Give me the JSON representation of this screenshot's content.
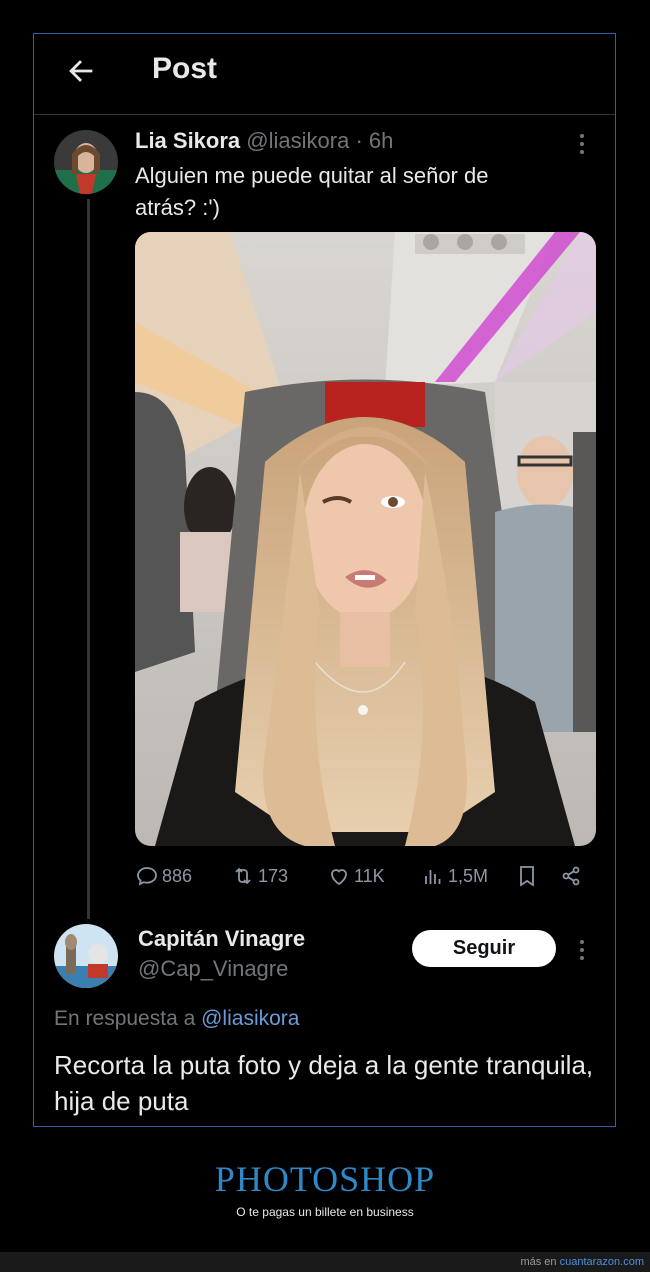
{
  "header": {
    "title": "Post"
  },
  "tweet": {
    "author_name": "Lia Sikora",
    "handle": "@liasikora",
    "separator": "·",
    "time": "6h",
    "text": "Alguien me puede quitar al señor de atrás? :')",
    "actions": {
      "replies": "886",
      "retweets": "173",
      "likes": "11K",
      "views": "1,5M"
    }
  },
  "reply": {
    "author_name": "Capitán Vinagre",
    "handle": "@Cap_Vinagre",
    "follow_label": "Seguir",
    "in_reply_prefix": "En respuesta a",
    "in_reply_handle": "@liasikora",
    "text": "Recorta la puta foto y deja a la gente tranquila, hija de puta"
  },
  "footer": {
    "title": "PHOTOSHOP",
    "subtitle": "O te pagas un billete en business",
    "credit_prefix": "más en",
    "credit_site": "cuantarazon.com"
  },
  "colors": {
    "accent_link": "#6b9bd8",
    "footer_title": "#2f88c8",
    "frame_border": "#2f5fa8"
  }
}
